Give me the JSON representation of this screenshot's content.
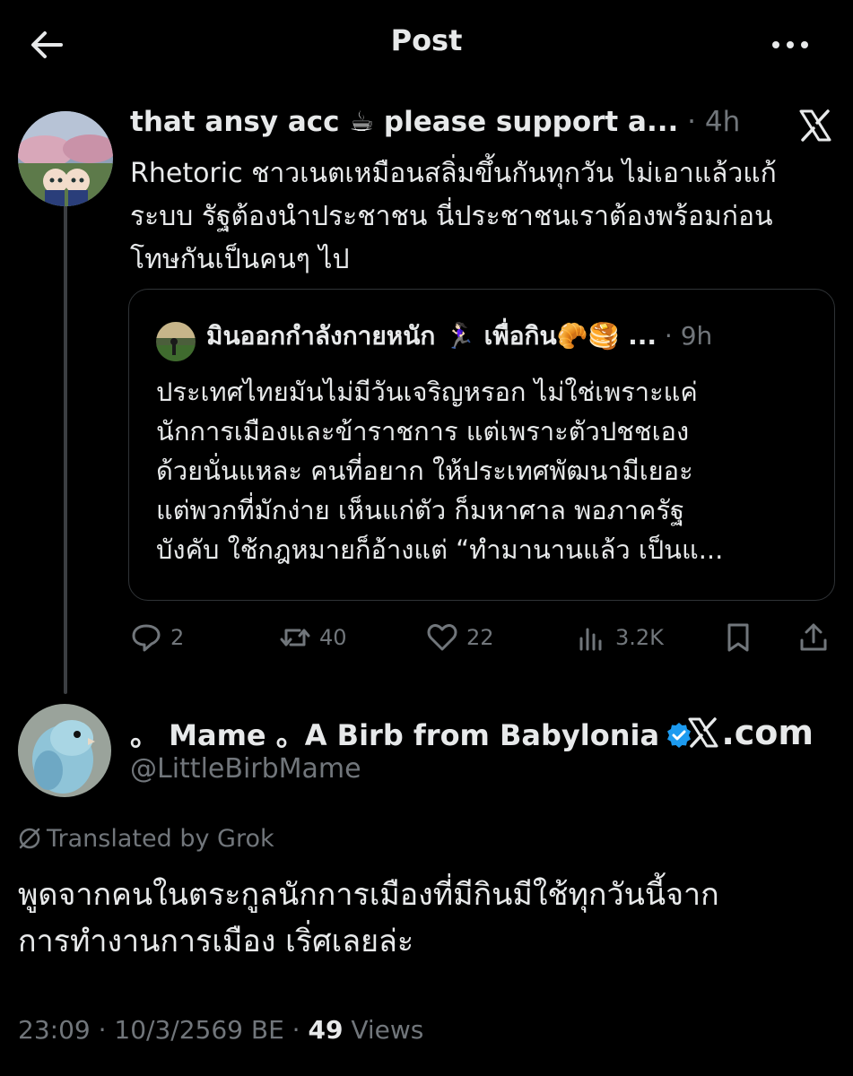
{
  "header": {
    "title": "Post",
    "back_icon": "arrow-left-icon",
    "more_icon": "more-horizontal-icon"
  },
  "tweet1": {
    "author": "that ansy acc ☕ please support a...",
    "separator": " · ",
    "time": "4h",
    "text_lines": [
      "Rhetoric ชาวเนตเหมือนสลิ่มขึ้นกันทุกวัน ไม่เอาแล้วแก้",
      "ระบบ รัฐต้องนำประชาชน นี่ประชาชนเราต้องพร้อมก่อน",
      "โทษกันเป็นคนๆ ไป"
    ],
    "quote": {
      "author": "มินออกกำลังกายหนัก 🏃🏻‍♀️ เพื่อกิน🥐🥞 ...",
      "separator": " · ",
      "time": "9h",
      "text_lines": [
        "ประเทศไทยมันไม่มีวันเจริญหรอก ไม่ใช่เพราะแค่",
        "นักการเมืองและข้าราชการ แต่เพราะตัวปชชเอง",
        "ด้วยนั่นแหละ คนที่อยาก ให้ประเทศพัฒนามีเยอะ",
        "แต่พวกที่มักง่าย เห็นแก่ตัว ก็มหาศาล พอภาครัฐ",
        "บังคับ ใช้กฎหมายก็อ้างแต่ “ทำมานานแล้ว เป็นแ..."
      ]
    },
    "actions": {
      "replies": "2",
      "reposts": "40",
      "likes": "22",
      "views": "3.2K"
    }
  },
  "tweet2": {
    "name": "。 Mame 。A Birb from Babylonia",
    "handle": "@LittleBirbMame",
    "watermark": ".com",
    "translated_label": "Translated by Grok",
    "text_lines": [
      "พูดจากคนในตระกูลนักการเมืองที่มีกินมีใช้ทุกวันนี้จาก",
      "การทำงานการเมือง เริ่ศเลยล่ะ"
    ],
    "timestamp": "23:09 · 10/3/2569 BE · ",
    "views_count": "49",
    "views_label": " Views"
  },
  "colors": {
    "background": "#000000",
    "text": "#e7e9ea",
    "muted": "#71767b",
    "border": "#2f3336",
    "verified": "#1d9bf0"
  }
}
